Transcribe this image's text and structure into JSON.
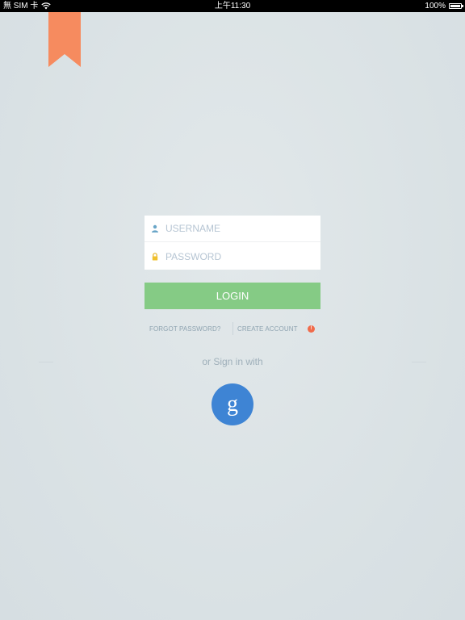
{
  "status_bar": {
    "carrier": "無 SIM 卡",
    "time": "上午11:30",
    "battery": "100%",
    "battery_level": 1.0
  },
  "colors": {
    "background": "#dbe3e6",
    "bookmark": "#f68b5f",
    "login_button": "#85cb85",
    "google_button": "#3e84d4",
    "badge": "#f06b4b"
  },
  "form": {
    "username_placeholder": "USERNAME",
    "username_value": "",
    "password_placeholder": "PASSWORD",
    "password_value": "",
    "username_icon": "user-icon",
    "password_icon": "lock-icon"
  },
  "login_label": "LOGIN",
  "links": {
    "forgot_password": "FORGOT PASSWORD?",
    "create_account": "CREATE ACCOUNT",
    "badge": "!"
  },
  "social": {
    "prompt": "or Sign in with",
    "google_label": "g",
    "google_icon": "google-icon"
  }
}
